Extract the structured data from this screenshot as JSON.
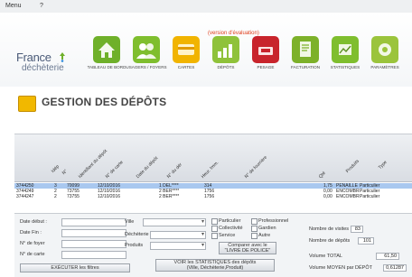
{
  "menu": {
    "label": "Menu",
    "extra": "?"
  },
  "app": {
    "logo_line1": "France",
    "logo_line2": "déchèterie",
    "version": "(version d'évaluation)"
  },
  "nav": [
    {
      "label": "TABLEAU DE BORD",
      "icon": "home-icon",
      "color": "#6fb02a"
    },
    {
      "label": "USAGERS / FOYERS",
      "icon": "users-icon",
      "color": "#7fbe2e"
    },
    {
      "label": "CARTES",
      "icon": "cards-icon",
      "color": "#f1b400"
    },
    {
      "label": "DÉPÔTS",
      "icon": "deposits-icon",
      "color": "#8fc23a"
    },
    {
      "label": "PESAGE",
      "icon": "weighing-icon",
      "color": "#c8242c"
    },
    {
      "label": "FACTURATION",
      "icon": "invoice-icon",
      "color": "#7db12a"
    },
    {
      "label": "STATISTIQUES",
      "icon": "stats-icon",
      "color": "#7fbe2e"
    },
    {
      "label": "PARAMÈTRES",
      "icon": "settings-icon",
      "color": "#9bc43c"
    }
  ],
  "page": {
    "title": "GESTION DES DÉPÔTS"
  },
  "table": {
    "columns": [
      "Idép",
      "N°",
      "Identifiant du dépôt",
      "N° de carte",
      "Date du dépôt",
      "N° du dér",
      "Heur. Imm.",
      "N° de fourrière",
      "Qté",
      "Produits",
      "Type"
    ],
    "rows": [
      {
        "id": "3744250",
        "n": "3",
        "dep": "70099",
        "date": "12/10/2016",
        "card": "1 DEL****",
        "heure": "314",
        "qte": "1,75",
        "unit": "PENAILLE",
        "type": "Particulier",
        "selected": true
      },
      {
        "id": "3744249",
        "n": "2",
        "dep": "73755",
        "date": "12/10/2016",
        "card": "2 BER****",
        "heure": "1756",
        "qte": "0,00",
        "unit": "ENCOMBR",
        "type": "Particulier",
        "selected": false
      },
      {
        "id": "3744247",
        "n": "2",
        "dep": "73755",
        "date": "12/10/2016",
        "card": "2 BER****",
        "heure": "1756",
        "qte": "0,00",
        "unit": "ENCOMBR",
        "type": "Particulier",
        "selected": false
      }
    ]
  },
  "filters": {
    "date_debut": "Date début :",
    "date_fin": "Date Fin :",
    "num_foyer": "N° de foyer",
    "num_carte": "N° de carte",
    "ville": "Ville",
    "decheterie": "Déchèterie",
    "produits": "Produits",
    "particulier": "Particulier",
    "professionnel": "Professionnel",
    "collectivite": "Collectivité",
    "gardien": "Gardien",
    "service": "Service",
    "autre": "Autre",
    "compare_btn_l1": "Comparer avec le",
    "compare_btn_l2": "\"LIVRE DE POLICE\"",
    "stats_btn_l1": "VOIR les STATISTIQUES des dépôts",
    "stats_btn_l2": "(Ville, Déchèterie,Produit)",
    "exec_btn": "EXÉCUTER les filtres",
    "stat_labels": {
      "nb_visites": "Nombre de visites",
      "nb_depots": "Nombre de dépôts",
      "volume_total": "Volume TOTAL",
      "volume_moyen": "Volume MOYEN par DÉPÔT"
    },
    "stat_values": {
      "nb_visites": "83",
      "nb_depots": "101",
      "volume_total": "61,50",
      "volume_moyen": "0,61287"
    }
  }
}
